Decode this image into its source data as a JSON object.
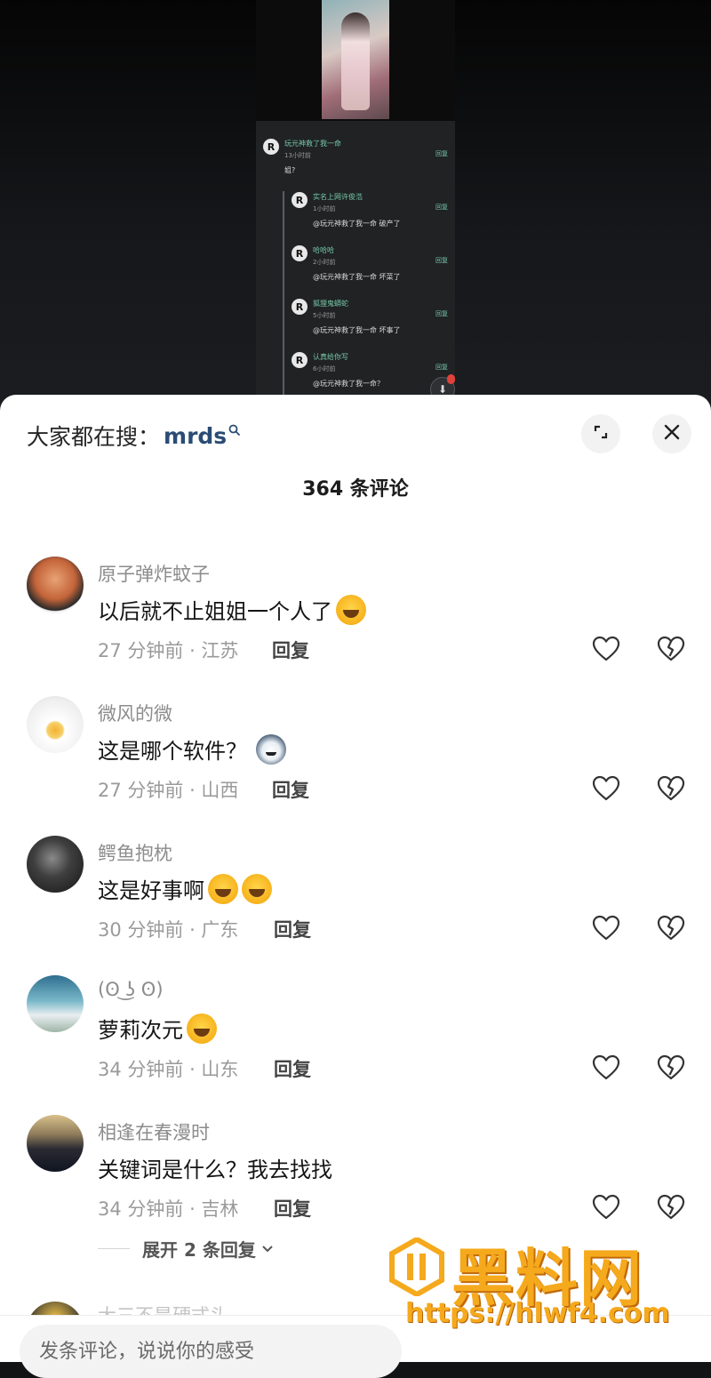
{
  "video_preview": {
    "comments": [
      {
        "name": "玩元神救了我一命",
        "time": "13小时前",
        "text": "姐?",
        "reply": "回复"
      },
      {
        "name": "实名上网许俊浩",
        "time": "1小时前",
        "text": "@玩元神救了我一命 破产了",
        "reply": "回复"
      },
      {
        "name": "哈哈哈",
        "time": "2小时前",
        "text": "@玩元神救了我一命 坏菜了",
        "reply": "回复"
      },
      {
        "name": "狐狸鬼蟒蛇",
        "time": "5小时前",
        "text": "@玩元神救了我一命 坏事了",
        "reply": "回复"
      },
      {
        "name": "认真给你写",
        "time": "6小时前",
        "text": "@玩元神救了我一命？",
        "reply": "回复"
      }
    ]
  },
  "sheet": {
    "search_prefix": "大家都在搜：",
    "search_keyword": "mrds",
    "comment_count_title": "364 条评论",
    "comments": [
      {
        "name": "原子弹炸蚊子",
        "text": "以后就不止姐姐一个人了",
        "emoji": [
          "laughing-tears-emoji"
        ],
        "time": "27 分钟前 · 江苏",
        "reply": "回复"
      },
      {
        "name": "微风的微",
        "text": "这是哪个软件？",
        "emoji": [
          "wolf-emoji"
        ],
        "time": "27 分钟前 · 山西",
        "reply": "回复"
      },
      {
        "name": "鳄鱼抱枕",
        "text": "这是好事啊",
        "emoji": [
          "crying-laugh-emoji",
          "crying-laugh-emoji"
        ],
        "time": "30 分钟前 · 广东",
        "reply": "回复"
      },
      {
        "name": "(ʘ ͜ʖ ʘ)",
        "text": "萝莉次元",
        "emoji": [
          "crying-laugh-emoji"
        ],
        "time": "34 分钟前 · 山东",
        "reply": "回复"
      },
      {
        "name": "相逢在春漫时",
        "text": "关键词是什么？我去找找",
        "emoji": [],
        "time": "34 分钟前 · 吉林",
        "reply": "回复"
      }
    ],
    "expand_replies_label": "展开 2 条回复",
    "next_comment_name_partial": "大三不是硬式头",
    "input_placeholder": "发条评论，说说你的感受"
  },
  "watermark": {
    "title": "黑料网",
    "url": "https://hlwf4.com"
  },
  "colors": {
    "accent_keyword": "#2a4c74",
    "watermark": "#f5a91c",
    "preview_green": "#77c9a8"
  }
}
